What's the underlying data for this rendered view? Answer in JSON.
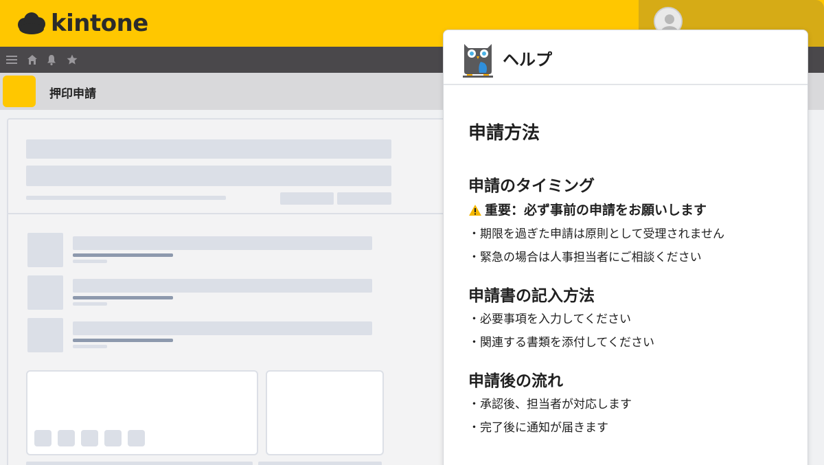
{
  "header": {
    "logo_text": "kintone"
  },
  "app": {
    "title": "押印申請"
  },
  "help": {
    "title": "ヘルプ",
    "heading": "申請方法",
    "sections": [
      {
        "title": "申請のタイミング",
        "warning": "重要：必ず事前の申請をお願いします",
        "items": [
          "・期限を過ぎた申請は原則として受理されません",
          "・緊急の場合は人事担当者にご相談ください"
        ]
      },
      {
        "title": "申請書の記入方法",
        "items": [
          "・必要事項を入力してください",
          "・関連する書類を添付してください"
        ]
      },
      {
        "title": "申請後の流れ",
        "items": [
          "・承認後、担当者が対応します",
          "・完了後に通知が届きます"
        ]
      }
    ]
  },
  "colors": {
    "brand_yellow": "#ffc700",
    "toolbar_dark": "#4a484b",
    "warning_yellow": "#f5b800"
  },
  "icons": [
    "menu-icon",
    "home-icon",
    "bell-icon",
    "star-icon",
    "user-avatar-icon",
    "owl-icon",
    "warning-icon"
  ]
}
